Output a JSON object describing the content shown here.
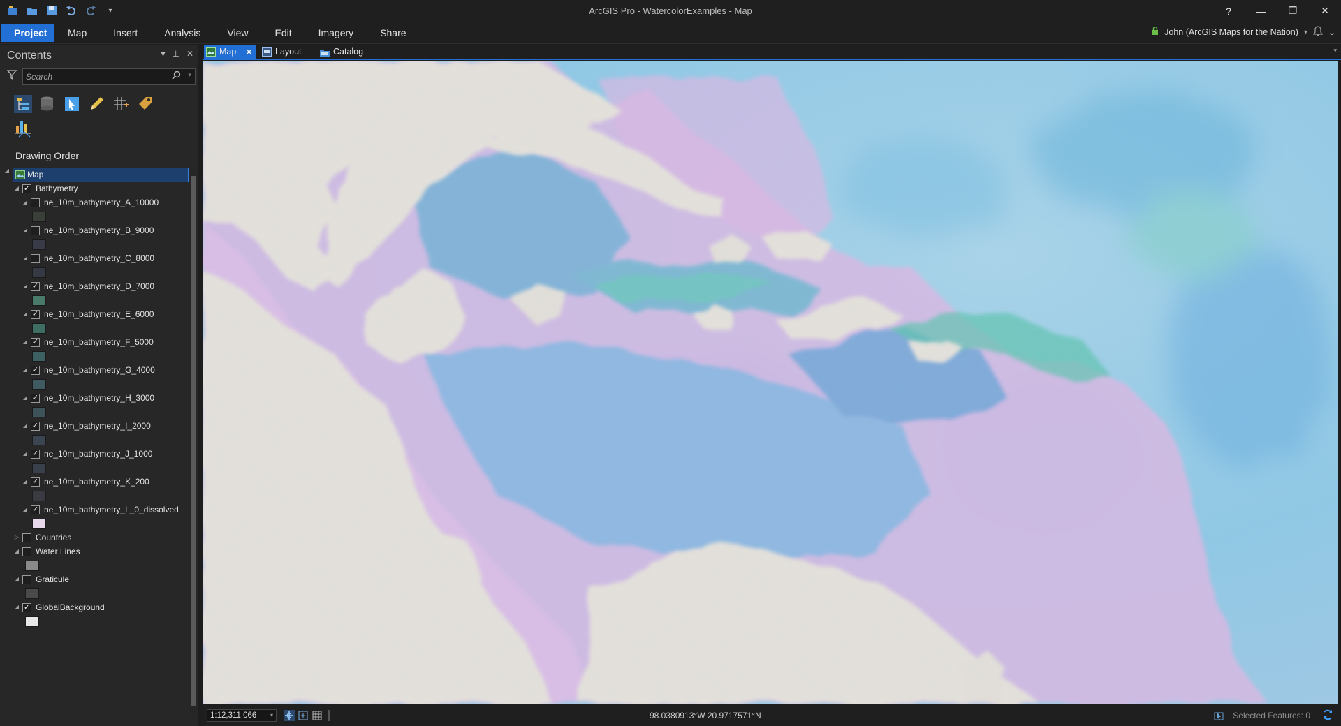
{
  "window": {
    "title": "ArcGIS Pro - WatercolorExamples - Map",
    "controls": {
      "help": "?",
      "minimize": "—",
      "restore": "❐",
      "close": "✕"
    }
  },
  "quick_access": {
    "icons": [
      "project-icon",
      "open-icon",
      "save-icon",
      "undo-icon",
      "redo-icon",
      "customize-icon"
    ]
  },
  "ribbon": {
    "tabs": [
      "Project",
      "Map",
      "Insert",
      "Analysis",
      "View",
      "Edit",
      "Imagery",
      "Share"
    ],
    "active_tab": "Project",
    "user": "John (ArcGIS Maps for the Nation)",
    "user_dropdown": "▾",
    "collapse": "⌄"
  },
  "contents": {
    "title": "Contents",
    "search_placeholder": "Search",
    "section_title": "Drawing Order",
    "map_label": "Map",
    "layers": [
      {
        "name": "Bathymetry",
        "checked": true,
        "expanded": true,
        "level": 0
      },
      {
        "name": "ne_10m_bathymetry_A_10000",
        "checked": false,
        "expanded": true,
        "level": 1,
        "swatch": "#3b3f3a"
      },
      {
        "name": "ne_10m_bathymetry_B_9000",
        "checked": false,
        "expanded": true,
        "level": 1,
        "swatch": "#3a3b48"
      },
      {
        "name": "ne_10m_bathymetry_C_8000",
        "checked": false,
        "expanded": true,
        "level": 1,
        "swatch": "#353944"
      },
      {
        "name": "ne_10m_bathymetry_D_7000",
        "checked": true,
        "expanded": true,
        "level": 1,
        "swatch": "#4a7a6a"
      },
      {
        "name": "ne_10m_bathymetry_E_6000",
        "checked": true,
        "expanded": true,
        "level": 1,
        "swatch": "#3e6e62"
      },
      {
        "name": "ne_10m_bathymetry_F_5000",
        "checked": true,
        "expanded": true,
        "level": 1,
        "swatch": "#3d6062"
      },
      {
        "name": "ne_10m_bathymetry_G_4000",
        "checked": true,
        "expanded": true,
        "level": 1,
        "swatch": "#3f5a60"
      },
      {
        "name": "ne_10m_bathymetry_H_3000",
        "checked": true,
        "expanded": true,
        "level": 1,
        "swatch": "#3e525a"
      },
      {
        "name": "ne_10m_bathymetry_I_2000",
        "checked": true,
        "expanded": true,
        "level": 1,
        "swatch": "#3b4552"
      },
      {
        "name": "ne_10m_bathymetry_J_1000",
        "checked": true,
        "expanded": true,
        "level": 1,
        "swatch": "#3a3f4c"
      },
      {
        "name": "ne_10m_bathymetry_K_200",
        "checked": true,
        "expanded": true,
        "level": 1,
        "swatch": "#3a3b42"
      },
      {
        "name": "ne_10m_bathymetry_L_0_dissolved",
        "checked": true,
        "expanded": true,
        "level": 1,
        "swatch": "#e8d8ec"
      },
      {
        "name": "Countries",
        "checked": false,
        "expanded": false,
        "level": 0
      },
      {
        "name": "Water Lines",
        "checked": false,
        "expanded": true,
        "level": 0,
        "swatch": "#8a8a8a"
      },
      {
        "name": "Graticule",
        "checked": false,
        "expanded": true,
        "level": 0,
        "swatch": "#4a4a4a"
      },
      {
        "name": "GlobalBackground",
        "checked": true,
        "expanded": true,
        "level": 0,
        "swatch": "#e8e8e8"
      }
    ]
  },
  "views": {
    "tabs": [
      {
        "label": "Map",
        "icon": "map-icon",
        "active": true
      },
      {
        "label": "Layout",
        "icon": "layout-icon",
        "active": false
      },
      {
        "label": "Catalog",
        "icon": "catalog-icon",
        "active": false
      }
    ]
  },
  "status": {
    "scale": "1:12,311,066",
    "coordinates": "98.0380913°W 20.9717571°N",
    "selected_features": "Selected Features: 0"
  },
  "colors": {
    "accent": "#2270d6",
    "land": "#e4e1dc",
    "water_light": "#a9d2e8",
    "water_mid": "#7cbde0",
    "shelf_pink": "#dcb6e6",
    "teal": "#5ec4b0"
  }
}
